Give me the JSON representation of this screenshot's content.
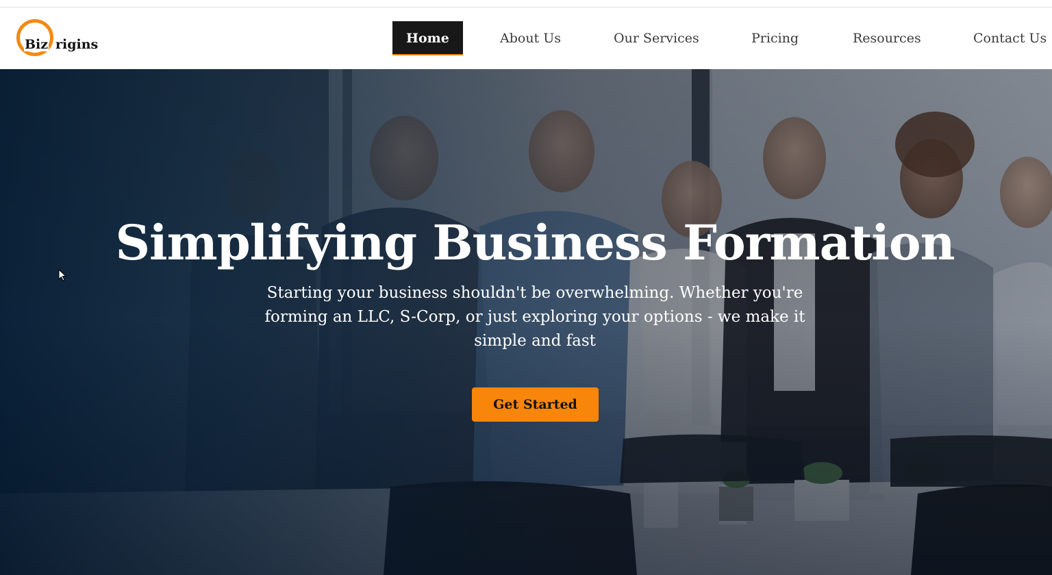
{
  "brand": {
    "logo_left": "Biz",
    "logo_right": "rigins",
    "accent_color": "#f48a12"
  },
  "nav": {
    "items": [
      {
        "label": "Home",
        "active": true
      },
      {
        "label": "About Us",
        "active": false
      },
      {
        "label": "Our Services",
        "active": false
      },
      {
        "label": "Pricing",
        "active": false
      },
      {
        "label": "Resources",
        "active": false
      },
      {
        "label": "Contact Us",
        "active": false
      }
    ]
  },
  "hero": {
    "title": "Simplifying Business Formation",
    "subtitle": "Starting your business shouldn't be overwhelming. Whether you're forming an LLC, S-Corp, or just exploring your options - we make it simple and fast",
    "cta_label": "Get Started",
    "cta_color": "#f8860b",
    "background_image": "office-team-photo"
  }
}
